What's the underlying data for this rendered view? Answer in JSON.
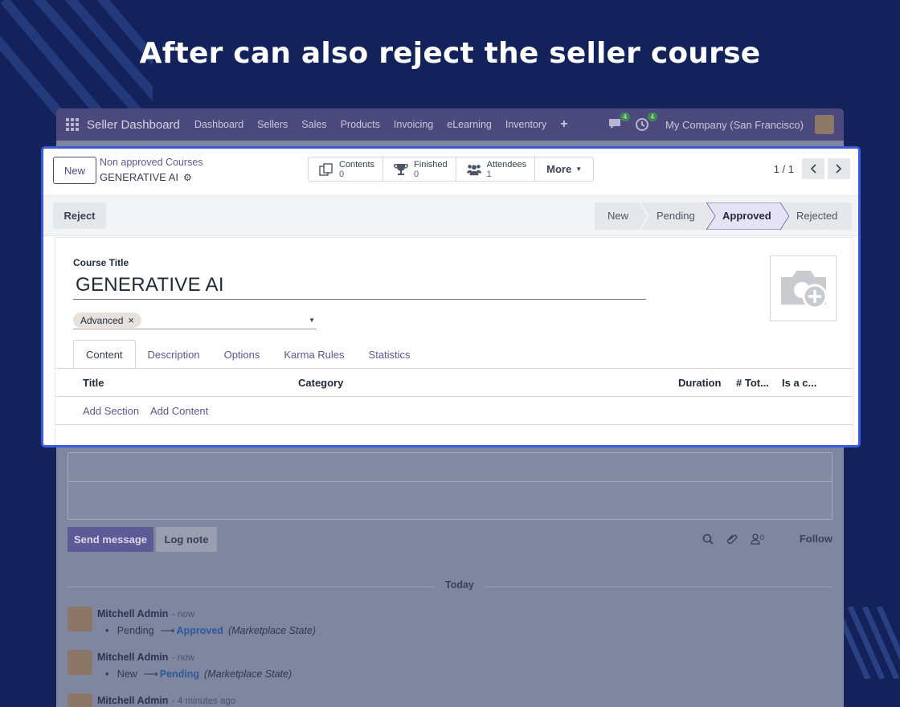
{
  "headline": "After can also reject the seller course",
  "navbar": {
    "brand": "Seller Dashboard",
    "items": [
      "Dashboard",
      "Sellers",
      "Sales",
      "Products",
      "Invoicing",
      "eLearning",
      "Inventory"
    ],
    "plus": "+",
    "messages_badge": "4",
    "activities_badge": "4",
    "company": "My Company (San Francisco)"
  },
  "control_panel": {
    "new_label": "New",
    "breadcrumb_parent": "Non approved Courses",
    "record_name": "GENERATIVE AI",
    "smart_buttons": [
      {
        "label": "Contents",
        "value": "0",
        "icon": "copy-icon"
      },
      {
        "label": "Finished",
        "value": "0",
        "icon": "trophy-icon"
      },
      {
        "label": "Attendees",
        "value": "1",
        "icon": "users-icon"
      }
    ],
    "more_label": "More",
    "pager": "1 / 1"
  },
  "statusbar": {
    "reject_label": "Reject",
    "stages": [
      "New",
      "Pending",
      "Approved",
      "Rejected"
    ],
    "active_stage": "Approved"
  },
  "form": {
    "course_title_label": "Course Title",
    "course_title_value": "GENERATIVE  AI",
    "tag": "Advanced",
    "tag_remove": "×",
    "tabs": [
      "Content",
      "Description",
      "Options",
      "Karma Rules",
      "Statistics"
    ],
    "active_tab": "Content",
    "columns": [
      "Title",
      "Category",
      "Duration",
      "# Tot...",
      "Is a c..."
    ],
    "add_section": "Add Section",
    "add_content": "Add Content"
  },
  "chatter": {
    "send_message": "Send message",
    "log_note": "Log note",
    "followers_count": "0",
    "follow": "Follow",
    "today": "Today",
    "messages": [
      {
        "author": "Mitchell Admin",
        "time": "- now",
        "from": "Pending",
        "arrow": "⟶",
        "to": "Approved",
        "field": "(Marketplace State)"
      },
      {
        "author": "Mitchell Admin",
        "time": "- now",
        "from": "New",
        "arrow": "⟶",
        "to": "Pending",
        "field": "(Marketplace State)"
      },
      {
        "author": "Mitchell Admin",
        "time": "- 4 minutes ago"
      }
    ]
  },
  "colors": {
    "background": "#13225a",
    "highlight_border": "#3a5bd9",
    "primary": "#5a5890"
  }
}
